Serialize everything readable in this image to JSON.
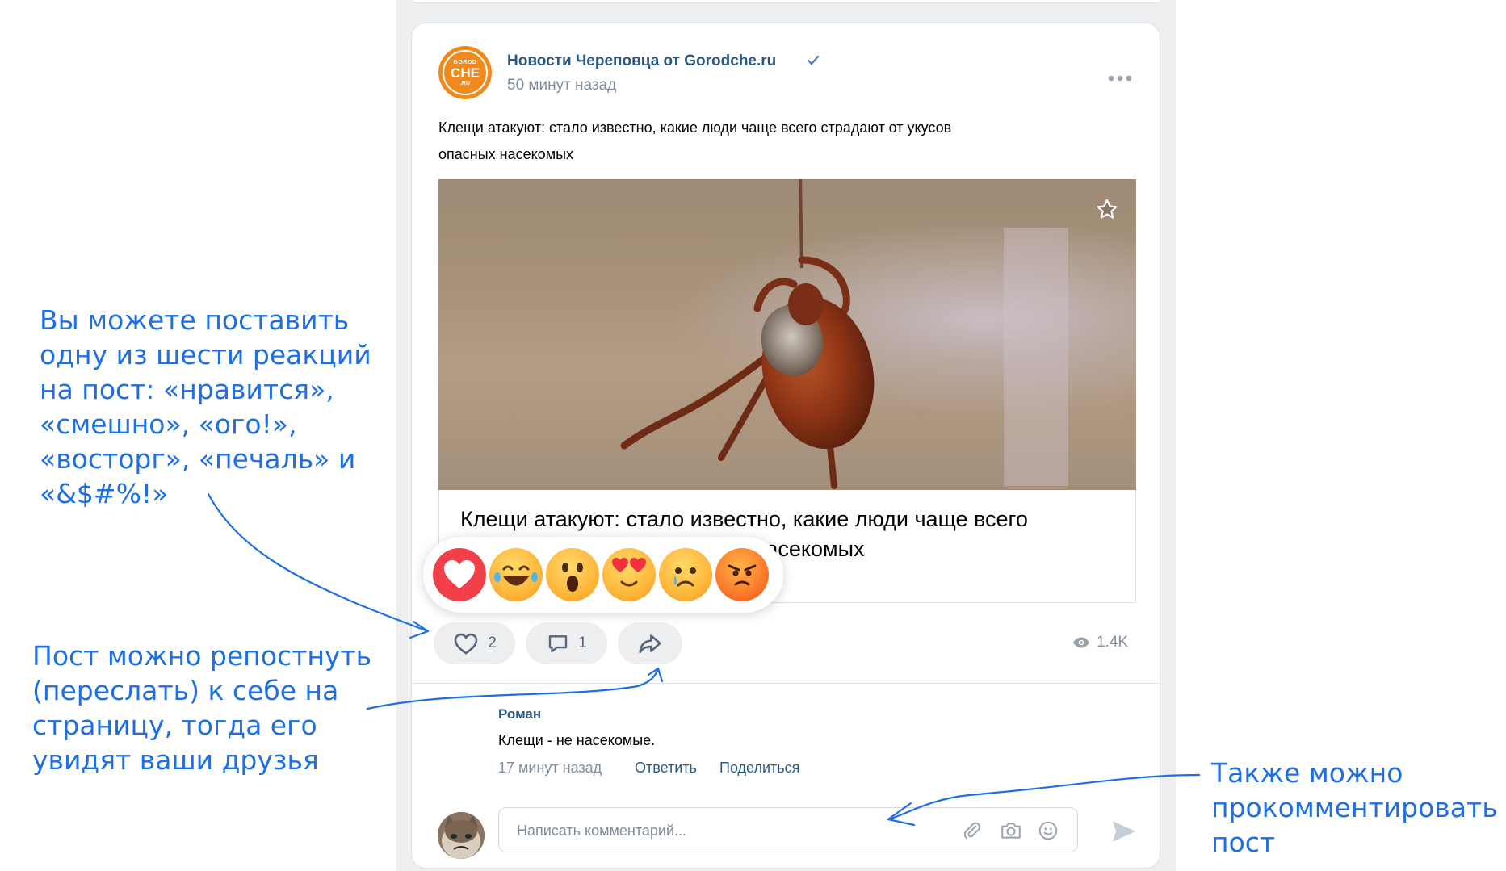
{
  "post": {
    "group_name": "Новости Череповца от Gorodche.ru",
    "time": "50 минут назад",
    "logo_text": {
      "top": "GOROD",
      "middle": "CHE",
      "bottom": ".RU"
    },
    "text_line1": "Клещи атакуют: стало известно, какие люди чаще всего страдают от укусов",
    "text_line2": "опасных насекомых",
    "link_title_line1": "Клещи атакуют: стало известно, какие люди чаще всего",
    "link_title_line2": "страдают от укусов опасных насекомых",
    "likes": "2",
    "comments": "1",
    "views": "1.4K"
  },
  "reactions": [
    "нравится",
    "смешно",
    "ого!",
    "восторг",
    "печаль",
    "&$#%!"
  ],
  "comment": {
    "author": "Роман",
    "text": "Клещи - не насекомые.",
    "time": "17 минут назад",
    "reply_label": "Ответить",
    "share_label": "Поделиться"
  },
  "comment_input": {
    "placeholder": "Написать комментарий..."
  },
  "annotations": {
    "reactions_note": "Вы можете поставить одну из шести реакций на пост: «нравится», «смешно», «ого!», «восторг», «печаль» и «&$#%!»",
    "repost_note": "Пост можно репостнуть (переслать) к себе на страницу, тогда его увидят ваши друзья",
    "comment_note": "Также можно прокомментировать пост"
  },
  "colors": {
    "annotation": "#1e6fe6",
    "link": "#2a5885",
    "secondary": "#818c99",
    "logo": "#f28a1b"
  },
  "icons": [
    "verified-icon",
    "more-icon",
    "star-icon",
    "heart-icon",
    "comment-icon",
    "share-icon",
    "eye-icon",
    "attach-icon",
    "camera-icon",
    "emoji-icon",
    "send-icon"
  ]
}
